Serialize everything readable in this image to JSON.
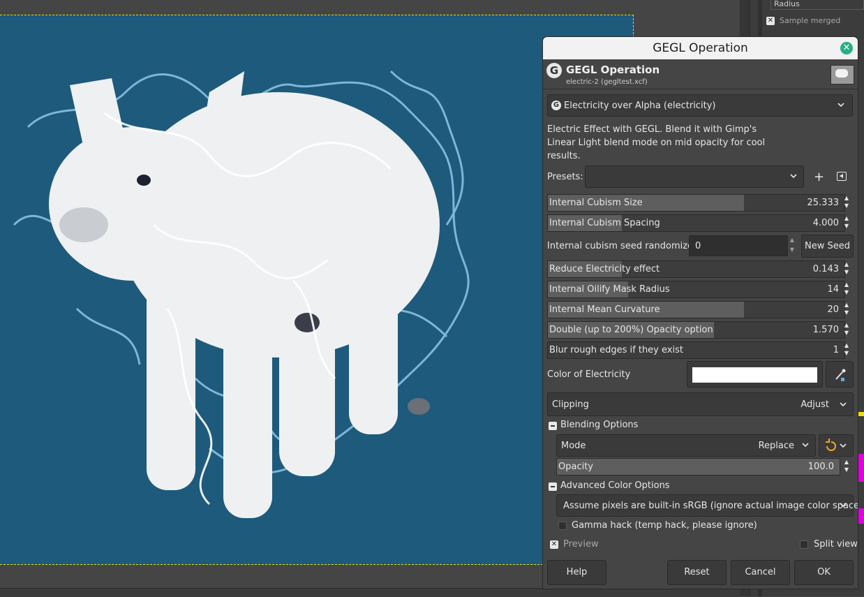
{
  "dialog": {
    "window_title": "GEGL Operation",
    "header_title": "GEGL Operation",
    "header_subtitle": "electric-2 (gegltest.xcf)",
    "operation": "Electricity over Alpha (electricity)",
    "description": "Electric Effect with GEGL. Blend it with Gimp's Linear Light blend mode on mid opacity for cool results.",
    "presets_label": "Presets:",
    "presets_value": "",
    "sliders": [
      {
        "label": "Internal Cubism Size",
        "value": "25.333",
        "fill": 0.66
      },
      {
        "label": "Internal Cubism Spacing",
        "value": "4.000",
        "fill": 0.25
      },
      {
        "label": "Reduce Electricity effect",
        "value": "0.143",
        "fill": 0.25
      },
      {
        "label": "Internal Oilify Mask Radius",
        "value": "14",
        "fill": 0.27
      },
      {
        "label": "Internal Mean Curvature",
        "value": "20",
        "fill": 0.66
      },
      {
        "label": "Double (up to 200%) Opacity option",
        "value": "1.570",
        "fill": 0.56
      },
      {
        "label": "Blur rough edges if they exist",
        "value": "1",
        "fill": 0.0
      }
    ],
    "seed": {
      "label": "Internal cubism seed randomizer",
      "value": "0",
      "button": "New Seed"
    },
    "color": {
      "label": "Color of Electricity",
      "value": "#ffffff"
    },
    "clipping": {
      "label": "Clipping",
      "value": "Adjust"
    },
    "blending": {
      "label": "Blending Options",
      "mode_label": "Mode",
      "mode_value": "Replace",
      "opacity_label": "Opacity",
      "opacity_value": "100.0"
    },
    "advanced": {
      "label": "Advanced Color Options",
      "color_space": "Assume pixels are built-in sRGB (ignore actual image color space)",
      "gamma_hack": "Gamma hack (temp hack, please ignore)"
    },
    "preview_label": "Preview",
    "split_view_label": "Split view",
    "buttons": {
      "help": "Help",
      "reset": "Reset",
      "cancel": "Cancel",
      "ok": "OK"
    }
  },
  "dock": {
    "radius_label": "Radius",
    "sample_merged_label": "Sample merged"
  },
  "icons": {
    "close": "close-icon",
    "gegl_logo": "gegl-logo-icon",
    "chevron": "chevron-down-icon",
    "add_preset": "plus-icon",
    "preset_menu": "menu-icon",
    "color_picker": "eyedropper-icon",
    "mode_switch": "reset-arrow-icon"
  },
  "colors": {
    "canvas_bg": "#1e5a7c",
    "close_button": "#27ae87",
    "mode_switch_icon": "#f5a623"
  }
}
